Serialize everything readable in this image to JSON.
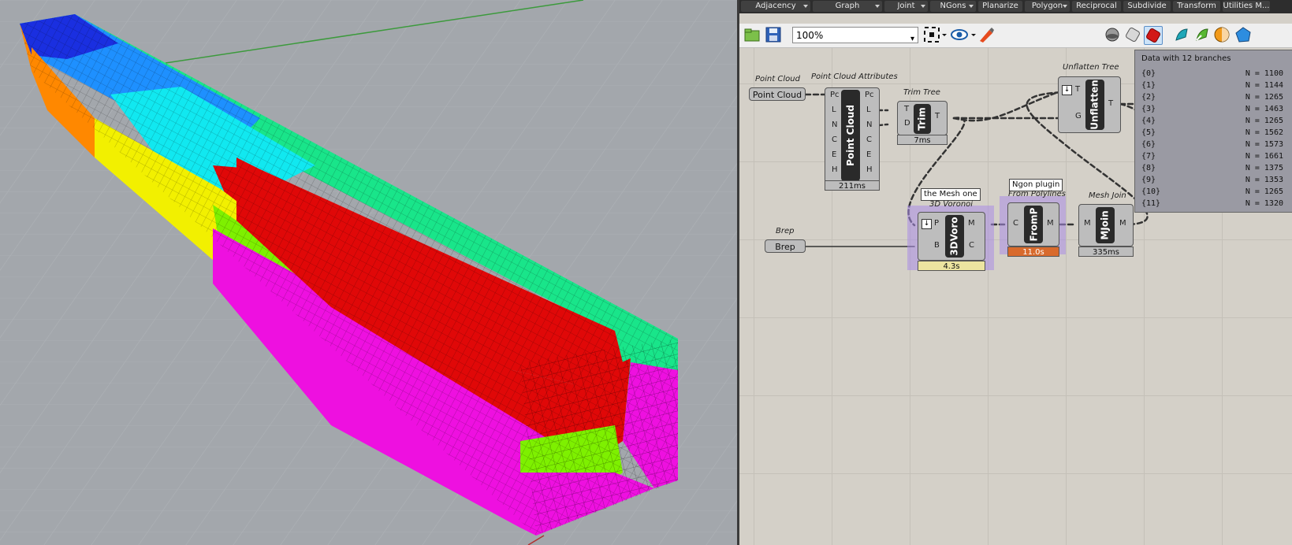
{
  "toolbar_tabs": [
    {
      "label": "Adjacency"
    },
    {
      "label": "Graph"
    },
    {
      "label": "Joint"
    },
    {
      "label": "NGons"
    },
    {
      "label": "Planarize"
    },
    {
      "label": "Polygon"
    },
    {
      "label": "Reciprocal"
    },
    {
      "label": "Subdivide"
    },
    {
      "label": "Transform"
    },
    {
      "label": "Utilities M..."
    }
  ],
  "zoom": {
    "value": "100%"
  },
  "icons": {
    "open": "folder-icon",
    "save": "save-icon",
    "zoom_extents": "zoom-extents-icon",
    "preview": "eye-icon",
    "sketch": "pen-icon",
    "preview_modes": [
      "shaded-preview-icon",
      "wire-preview-icon",
      "red-preview-icon"
    ],
    "display_modes": [
      "teal-brush-icon",
      "green-brush-icon",
      "orange-sphere-icon",
      "blue-sphere-icon"
    ]
  },
  "colors": {
    "mesh_blue": "#1a2fe0",
    "mesh_sky": "#1e90ff",
    "mesh_cyan": "#11e8f0",
    "mesh_green": "#19e58a",
    "mesh_red": "#e00808",
    "mesh_lime": "#7ef000",
    "mesh_yellow": "#f2f000",
    "mesh_orange": "#ff8800",
    "mesh_magenta": "#ee10e0",
    "time_yellow": "#ece4a0",
    "time_orange": "#d86a2c",
    "group_purple": "#b89ae8"
  },
  "nodes": {
    "point_cloud": {
      "caption": "Point Cloud",
      "label": "Point Cloud"
    },
    "pc_attributes": {
      "caption": "Point Cloud Attributes",
      "name": "Point Cloud",
      "inputs": [
        "Pc",
        "L",
        "N",
        "C",
        "E",
        "H"
      ],
      "outputs": [
        "Pc",
        "L",
        "N",
        "C",
        "E",
        "H"
      ],
      "time": "211ms"
    },
    "trim_tree": {
      "caption": "Trim Tree",
      "name": "Trim",
      "inputs": [
        "T",
        "D"
      ],
      "outputs": [
        "T"
      ],
      "time": "7ms"
    },
    "unflatten_tree": {
      "caption": "Unflatten Tree",
      "name": "Unflatten",
      "inputs": [
        "T",
        "G"
      ],
      "outputs": [
        "T"
      ]
    },
    "brep": {
      "caption": "Brep",
      "label": "Brep"
    },
    "voronoi": {
      "caption": "3D Voronoi",
      "name": "3DVoro",
      "inputs": [
        "P",
        "B"
      ],
      "outputs": [
        "M",
        "C"
      ],
      "time": "4.3s",
      "bubble": "the Mesh one"
    },
    "from_polylines": {
      "caption": "From Polylines",
      "name": "FromP",
      "inputs": [
        "C"
      ],
      "outputs": [
        "M"
      ],
      "time": "11.0s",
      "bubble": "Ngon plugin"
    },
    "mesh_join": {
      "caption": "Mesh Join",
      "name": "MJoin",
      "inputs": [
        "M"
      ],
      "outputs": [
        "M"
      ],
      "time": "335ms"
    }
  },
  "panel": {
    "title": "Data with 12 branches",
    "rows": [
      {
        "path": "{0}",
        "count": "N = 1100"
      },
      {
        "path": "{1}",
        "count": "N = 1144"
      },
      {
        "path": "{2}",
        "count": "N = 1265"
      },
      {
        "path": "{3}",
        "count": "N = 1463"
      },
      {
        "path": "{4}",
        "count": "N = 1265"
      },
      {
        "path": "{5}",
        "count": "N = 1562"
      },
      {
        "path": "{6}",
        "count": "N = 1573"
      },
      {
        "path": "{7}",
        "count": "N = 1661"
      },
      {
        "path": "{8}",
        "count": "N = 1375"
      },
      {
        "path": "{9}",
        "count": "N = 1353"
      },
      {
        "path": "{10}",
        "count": "N = 1265"
      },
      {
        "path": "{11}",
        "count": "N = 1320"
      }
    ]
  }
}
